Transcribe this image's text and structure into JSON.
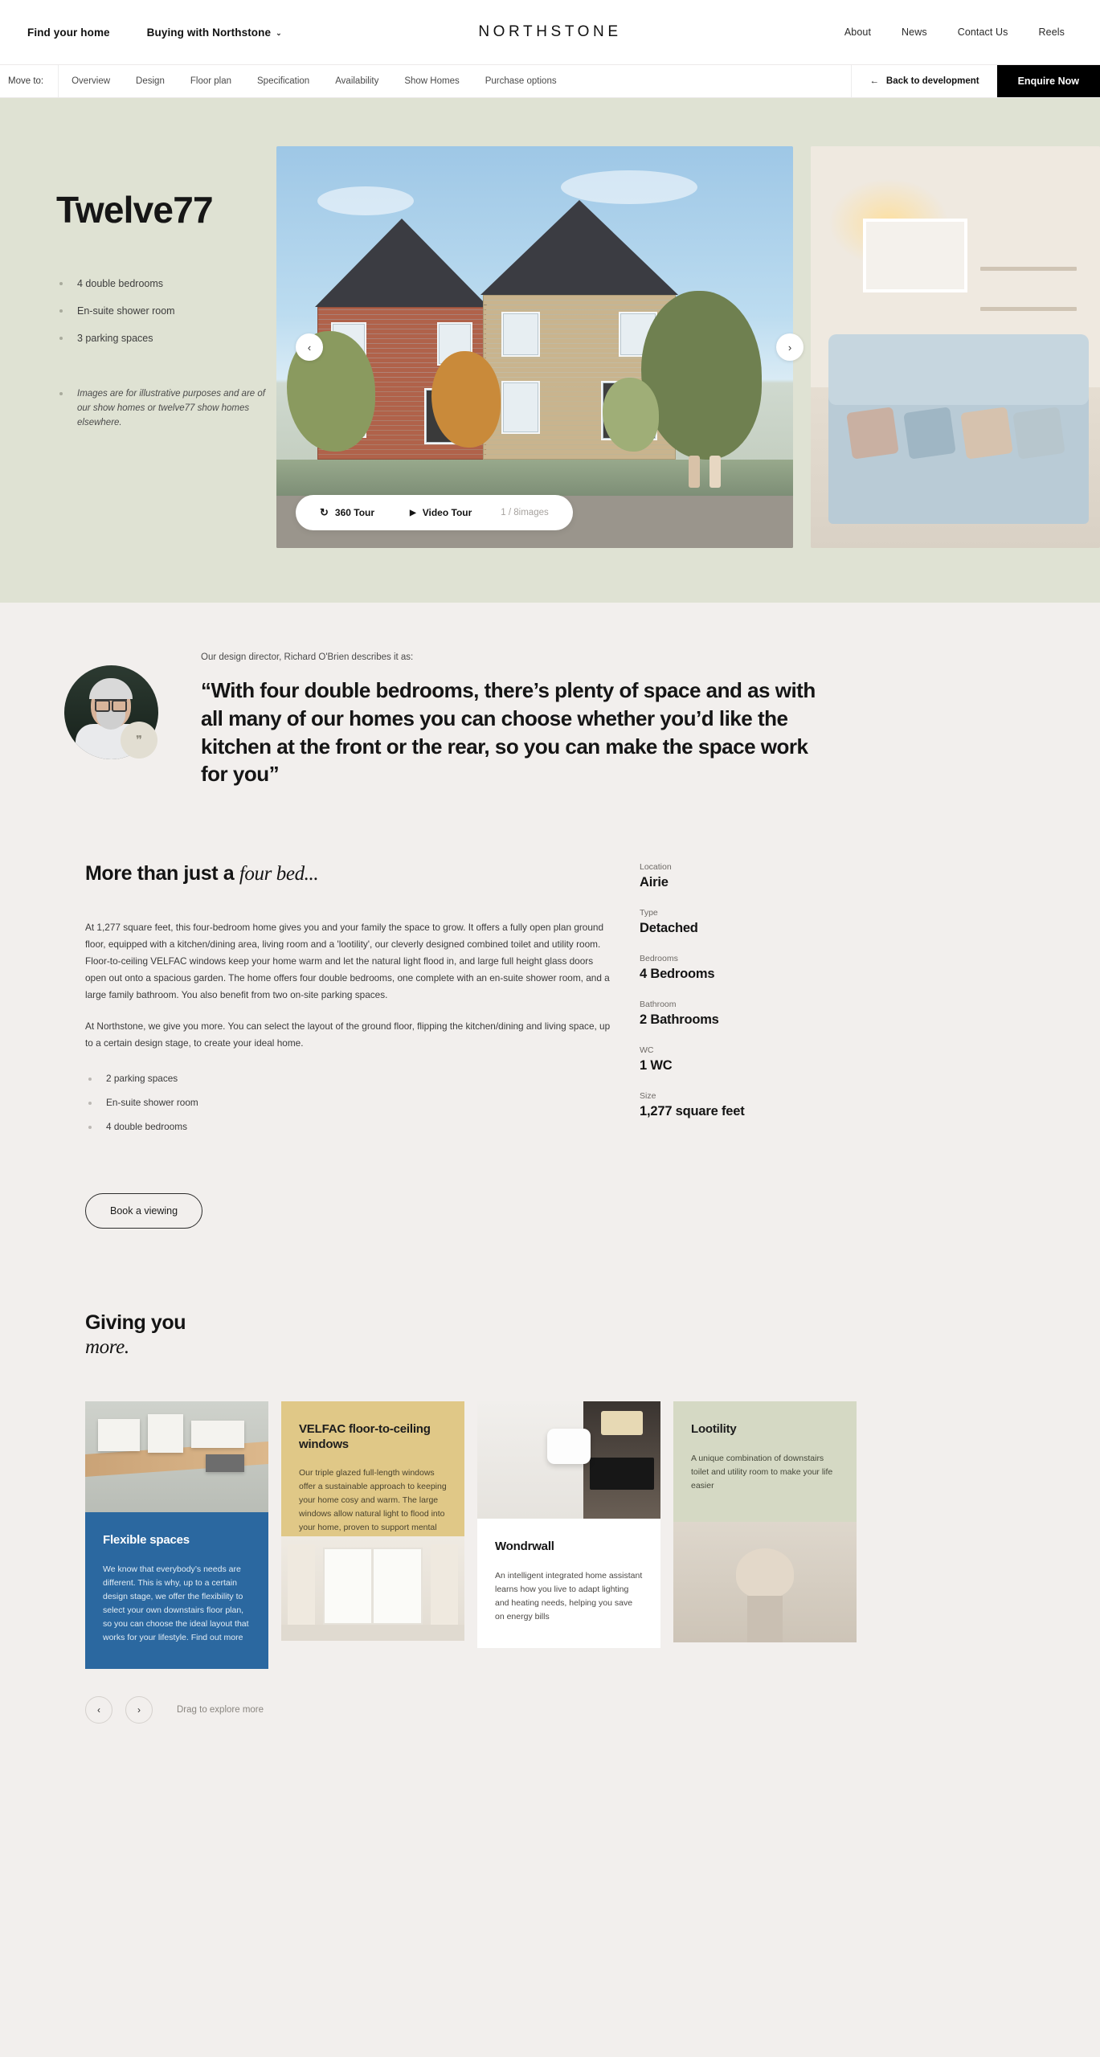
{
  "header": {
    "brand": "NORTHSTONE",
    "left_nav": [
      {
        "label": "Find your home",
        "has_chevron": false
      },
      {
        "label": "Buying with Northstone",
        "has_chevron": true
      }
    ],
    "right_nav": [
      "About",
      "News",
      "Contact Us",
      "Reels"
    ],
    "chevron": "⌄"
  },
  "subnav": {
    "move_to_label": "Move to:",
    "items": [
      "Overview",
      "Design",
      "Floor plan",
      "Specification",
      "Availability",
      "Show Homes",
      "Purchase options"
    ],
    "back_label": "Back to development",
    "back_icon": "←",
    "enquire_label": "Enquire Now"
  },
  "hero": {
    "title": "Twelve77",
    "features": [
      "4 double bedrooms",
      "En-suite shower room",
      "3 parking spaces"
    ],
    "note": "Images are for illustrative purposes and are of our show homes or twelve77 show homes elsewhere.",
    "prev_icon": "‹",
    "next_icon": "›",
    "tour_360_label": "360 Tour",
    "tour_360_icon": "↻",
    "video_tour_label": "Video Tour",
    "video_tour_icon": "▶",
    "image_count": "1 / 8images"
  },
  "quote": {
    "kicker": "Our design director, Richard O'Brien describes it as:",
    "text": "“With four double bedrooms, there’s plenty of space and as with all many of our homes you can choose whether you’d like the kitchen at the front or the rear, so you can make the space work for you”",
    "badge_icon": "❞"
  },
  "details": {
    "title_plain": "More than just a ",
    "title_italic": "four bed...",
    "paragraph_1": "At 1,277 square feet, this four-bedroom home gives you and your family the space to grow. It offers a fully open plan ground floor, equipped with a kitchen/dining area, living room and a 'lootility', our cleverly designed combined toilet and utility room. Floor-to-ceiling VELFAC windows keep your home warm and let the natural light flood in, and large full height glass doors open out onto a spacious garden. The home offers four double bedrooms, one complete with an en-suite shower room, and a large family bathroom. You also benefit from two on-site parking spaces.",
    "paragraph_2": "At Northstone, we give you more. You can select the layout of the ground floor, flipping the kitchen/dining and living space, up to a certain design stage, to create your ideal home.",
    "features": [
      "2 parking spaces",
      "En-suite shower room",
      "4 double bedrooms"
    ],
    "cta_label": "Book a viewing",
    "specs": [
      {
        "label": "Location",
        "value": "Airie"
      },
      {
        "label": "Type",
        "value": "Detached"
      },
      {
        "label": "Bedrooms",
        "value": "4 Bedrooms"
      },
      {
        "label": "Bathroom",
        "value": "2 Bathrooms"
      },
      {
        "label": "WC",
        "value": "1 WC"
      },
      {
        "label": "Size",
        "value": "1,277 square feet"
      }
    ]
  },
  "giving": {
    "title_line1": "Giving you",
    "title_line2": "more.",
    "cards": [
      {
        "heading": "Flexible spaces",
        "body": "We know that everybody’s needs are different. This is why, up to a certain design stage, we offer the flexibility to select your own downstairs floor plan, so you can choose the ideal layout that works for your lifestyle. Find out more"
      },
      {
        "heading": "VELFAC floor-to-ceiling windows",
        "body": "Our triple glazed full-length windows offer a sustainable approach to keeping your home cosy and warm. The large windows allow natural light to flood into your home, proven to support mental wellbeing."
      },
      {
        "heading": "Wondrwall",
        "body": "An intelligent integrated home assistant learns how you live to adapt lighting and heating needs, helping you save on energy bills"
      },
      {
        "heading": "Lootility",
        "body": "A unique combination of downstairs toilet and utility room to make your life easier"
      }
    ],
    "prev_icon": "‹",
    "next_icon": "›",
    "drag_hint": "Drag to explore more"
  },
  "colors": {
    "hero_bg": "#dfe2d3",
    "page_bg": "#f2efed",
    "accent_blue": "#2b68a0",
    "accent_sand": "#e0c887",
    "accent_sage": "#d5d9c4",
    "black": "#000000"
  }
}
